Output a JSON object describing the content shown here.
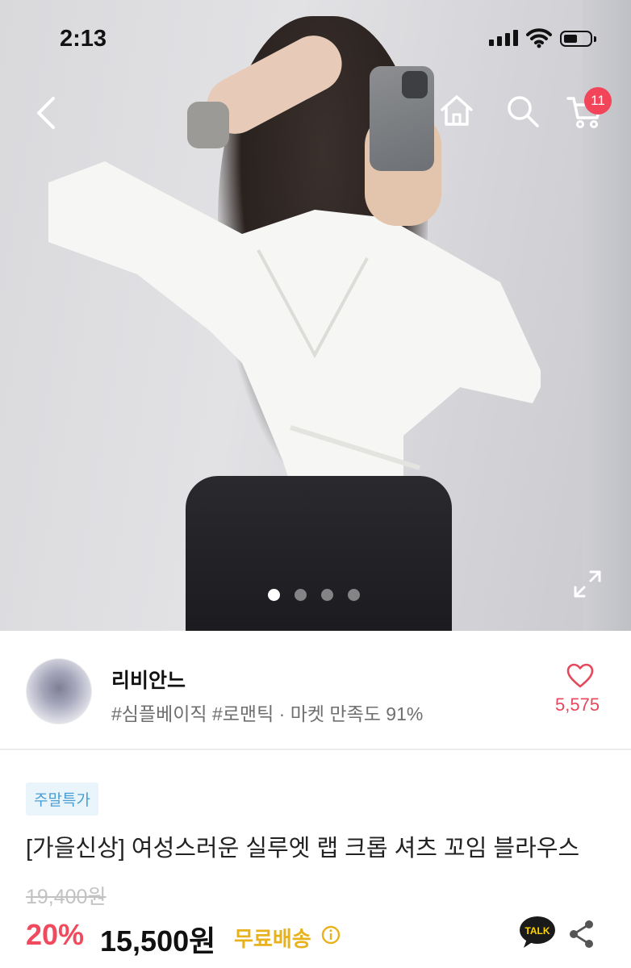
{
  "status_bar": {
    "time": "2:13"
  },
  "header": {
    "cart_count": "11"
  },
  "gallery": {
    "total_images": 4,
    "active_index": 1
  },
  "store": {
    "name": "리비안느",
    "tags": "#심플베이직 #로맨틱 · 마켓 만족도 91%",
    "likes": "5,575"
  },
  "product": {
    "badge": "주말특가",
    "title": "[가을신상] 여성스러운 실루엣 랩 크롭 셔츠 꼬임 블라우스",
    "original_price": "19,400원",
    "discount": "20%",
    "price": "15,500원",
    "shipping": "무료배송",
    "talk_label": "TALK"
  },
  "colors": {
    "accent_red": "#f04a5e",
    "shipping_yellow": "#e7b21d",
    "badge_blue": "#4a9ed6",
    "cart_badge": "#f3455a"
  },
  "icons": [
    "back-icon",
    "home-icon",
    "search-icon",
    "cart-icon",
    "expand-icon",
    "heart-icon",
    "info-icon",
    "kakao-talk-icon",
    "share-icon"
  ]
}
